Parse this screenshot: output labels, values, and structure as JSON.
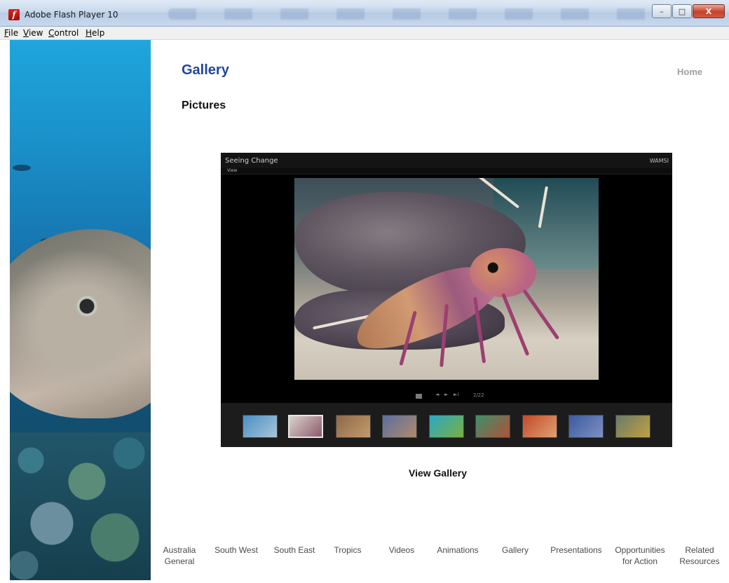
{
  "window": {
    "title": "Adobe Flash Player 10",
    "minimize_symbol": "–",
    "maximize_symbol": "□",
    "close_symbol": "X"
  },
  "menu": {
    "items": [
      "File",
      "View",
      "Control",
      "Help"
    ]
  },
  "page": {
    "title": "Gallery",
    "home_link": "Home",
    "section_heading": "Pictures",
    "view_gallery_label": "View Gallery"
  },
  "viewer": {
    "title": "Seeing Change",
    "brand": "WAMSI",
    "menu_label": "View",
    "counter": "2/22",
    "prev_symbol": "◄",
    "play_symbol": "►",
    "next_symbol": "►I",
    "thumbnails": [
      {
        "label": "thumb-1",
        "colors": [
          "#4a8fc2",
          "#a9c4d8"
        ]
      },
      {
        "label": "thumb-2",
        "colors": [
          "#d9d4cc",
          "#8e5a6c"
        ]
      },
      {
        "label": "thumb-3",
        "colors": [
          "#8b6a4a",
          "#c59a6a"
        ]
      },
      {
        "label": "thumb-4",
        "colors": [
          "#5a6f9e",
          "#b08a6a"
        ]
      },
      {
        "label": "thumb-5",
        "colors": [
          "#2aa8c4",
          "#7ab040"
        ]
      },
      {
        "label": "thumb-6",
        "colors": [
          "#3e8f6a",
          "#b0503a"
        ]
      },
      {
        "label": "thumb-7",
        "colors": [
          "#c24a2a",
          "#e0a070"
        ]
      },
      {
        "label": "thumb-8",
        "colors": [
          "#3a5aa0",
          "#8090c0"
        ]
      },
      {
        "label": "thumb-9",
        "colors": [
          "#6a7a6a",
          "#c0a040"
        ]
      }
    ]
  },
  "bottom_nav": [
    {
      "line1": "Australia",
      "line2": "General"
    },
    {
      "line1": "South West",
      "line2": ""
    },
    {
      "line1": "South East",
      "line2": ""
    },
    {
      "line1": "Tropics",
      "line2": ""
    },
    {
      "line1": "Videos",
      "line2": ""
    },
    {
      "line1": "Animations",
      "line2": ""
    },
    {
      "line1": "Gallery",
      "line2": ""
    },
    {
      "line1": "Presentations",
      "line2": ""
    },
    {
      "line1": "Opportunities",
      "line2": "for Action"
    },
    {
      "line1": "Related",
      "line2": "Resources"
    }
  ],
  "colors": {
    "title_blue": "#21479b",
    "nav_text": "#4a4a4a",
    "home_gray": "#a0a0a0"
  }
}
